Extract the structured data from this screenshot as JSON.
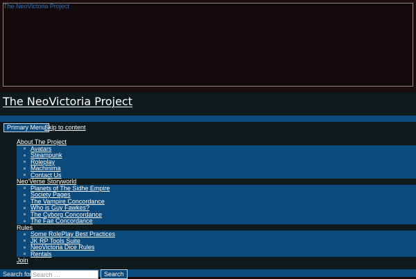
{
  "header": {
    "image_alt": "The NeoVictoria Project"
  },
  "site": {
    "title": "The NeoVictoria Project"
  },
  "nav": {
    "primary_menu_label": "Primary Menu",
    "skip_link": "Skip to content",
    "groups": [
      {
        "label": "About The Project",
        "items": [
          "Avatars",
          "Steampunk",
          "Roleplay",
          "Machinima",
          "Contact Us"
        ]
      },
      {
        "label": "Neo'Verse Storyworld",
        "items": [
          "Planets of The Sidhe Empire",
          "Society Pages",
          "The Vampire Concordance",
          "Who is Guy Fawkes?",
          "The Cyborg Concordance",
          "The Fae Concordance"
        ]
      },
      {
        "label": "Rules",
        "items": [
          "Some RolePlay Best Practices",
          "JK RP Tools Suite",
          "NeoVictoria Dice Rules",
          "Rentals"
        ]
      },
      {
        "label": "Join",
        "items": []
      }
    ]
  },
  "search": {
    "label": "Search for:",
    "placeholder": "Search …",
    "button": "Search"
  },
  "colors": {
    "background": "#1c0d0c",
    "nav_dark": "#0e1a1c",
    "accent_blue": "#0b4a7c",
    "link_blue": "#2f6fb5"
  }
}
